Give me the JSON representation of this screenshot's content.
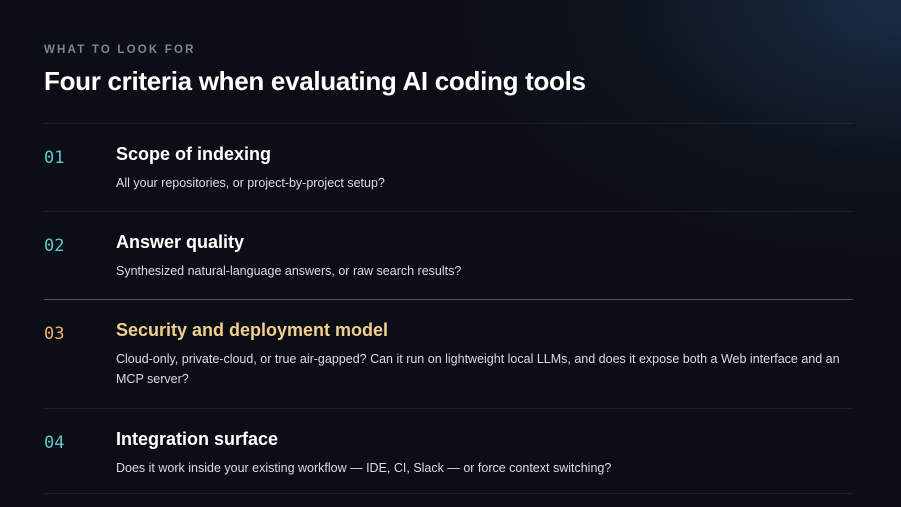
{
  "eyebrow": "WHAT TO LOOK FOR",
  "headline": "Four criteria when evaluating AI coding tools",
  "colors": {
    "background": "#0b0e14",
    "number_teal": "#5fc8c8",
    "number_accent": "#e8b070",
    "title_accent": "#f1cf8e",
    "eyebrow": "#7d8590"
  },
  "criteria": [
    {
      "number": "01",
      "title": "Scope of indexing",
      "description": "All your repositories, or project-by-project setup?",
      "highlighted": false
    },
    {
      "number": "02",
      "title": "Answer quality",
      "description": "Synthesized natural-language answers, or raw search results?",
      "highlighted": false
    },
    {
      "number": "03",
      "title": "Security and deployment model",
      "description": "Cloud-only, private-cloud, or true air-gapped? Can it run on lightweight local LLMs, and does it expose both a Web interface and an MCP server?",
      "highlighted": true
    },
    {
      "number": "04",
      "title": "Integration surface",
      "description": "Does it work inside your existing workflow — IDE, CI, Slack — or force context switching?",
      "highlighted": false
    }
  ]
}
